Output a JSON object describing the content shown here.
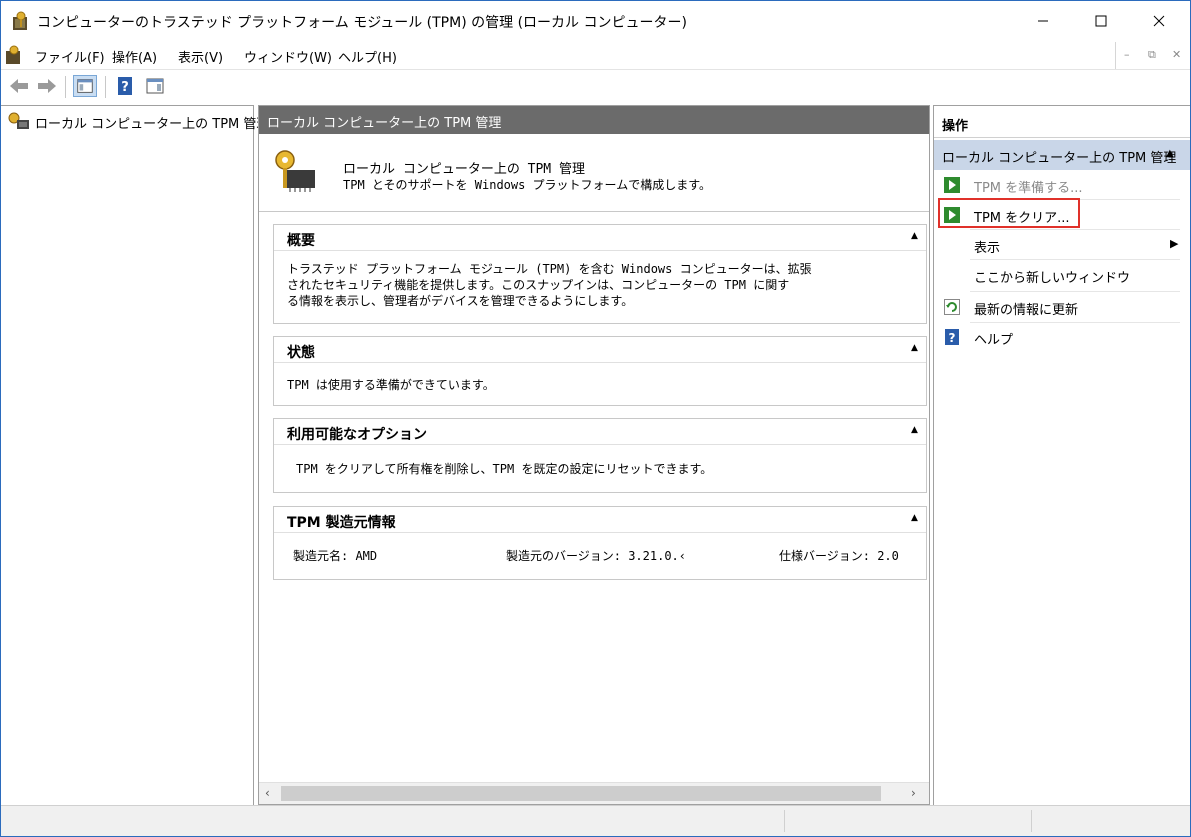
{
  "window": {
    "title": "コンピューターのトラステッド プラットフォーム モジュール (TPM) の管理 (ローカル コンピューター)"
  },
  "menu": {
    "items": [
      "ファイル(F)",
      "操作(A)",
      "表示(V)",
      "ウィンドウ(W)",
      "ヘルプ(H)"
    ]
  },
  "tree": {
    "item_label": "ローカル コンピューター上の TPM 管理"
  },
  "center": {
    "header": "ローカル コンピューター上の TPM 管理",
    "intro_title": "ローカル コンピューター上の TPM 管理",
    "intro_desc": "TPM とそのサポートを Windows プラットフォームで構成します。",
    "sections": {
      "overview": {
        "title": "概要",
        "line1": "トラステッド プラットフォーム モジュール (TPM) を含む Windows コンピューターは、拡張",
        "line2": "されたセキュリティ機能を提供します。このスナップインは、コンピューターの TPM に関す",
        "line3": "る情報を表示し、管理者がデバイスを管理できるようにします。"
      },
      "status": {
        "title": "状態",
        "body": "TPM は使用する準備ができています。"
      },
      "options": {
        "title": "利用可能なオプション",
        "body": "TPM をクリアして所有権を削除し、TPM を既定の設定にリセットできます。"
      },
      "manufacturer": {
        "title": "TPM 製造元情報",
        "name": "製造元名: AMD",
        "version": "製造元のバージョン: 3.21.0.‹",
        "spec": "仕様バージョン: 2.0"
      }
    }
  },
  "actions": {
    "header": "操作",
    "group_label": "ローカル コンピューター上の TPM 管理",
    "items": [
      {
        "label": "TPM を準備する...",
        "icon": "green-arrow-icon",
        "disabled": true
      },
      {
        "label": "TPM をクリア...",
        "icon": "green-arrow-icon",
        "highlighted": true
      },
      {
        "label": "表示",
        "icon": "",
        "submenu": true
      },
      {
        "label": "ここから新しいウィンドウ",
        "icon": ""
      },
      {
        "label": "最新の情報に更新",
        "icon": "refresh-icon"
      },
      {
        "label": "ヘルプ",
        "icon": "help-icon"
      }
    ]
  },
  "colors": {
    "header_bg": "#6b6b6b",
    "group_bg": "#c9d6e8",
    "highlight": "#e0312a",
    "window_border": "#2b6bbd"
  }
}
